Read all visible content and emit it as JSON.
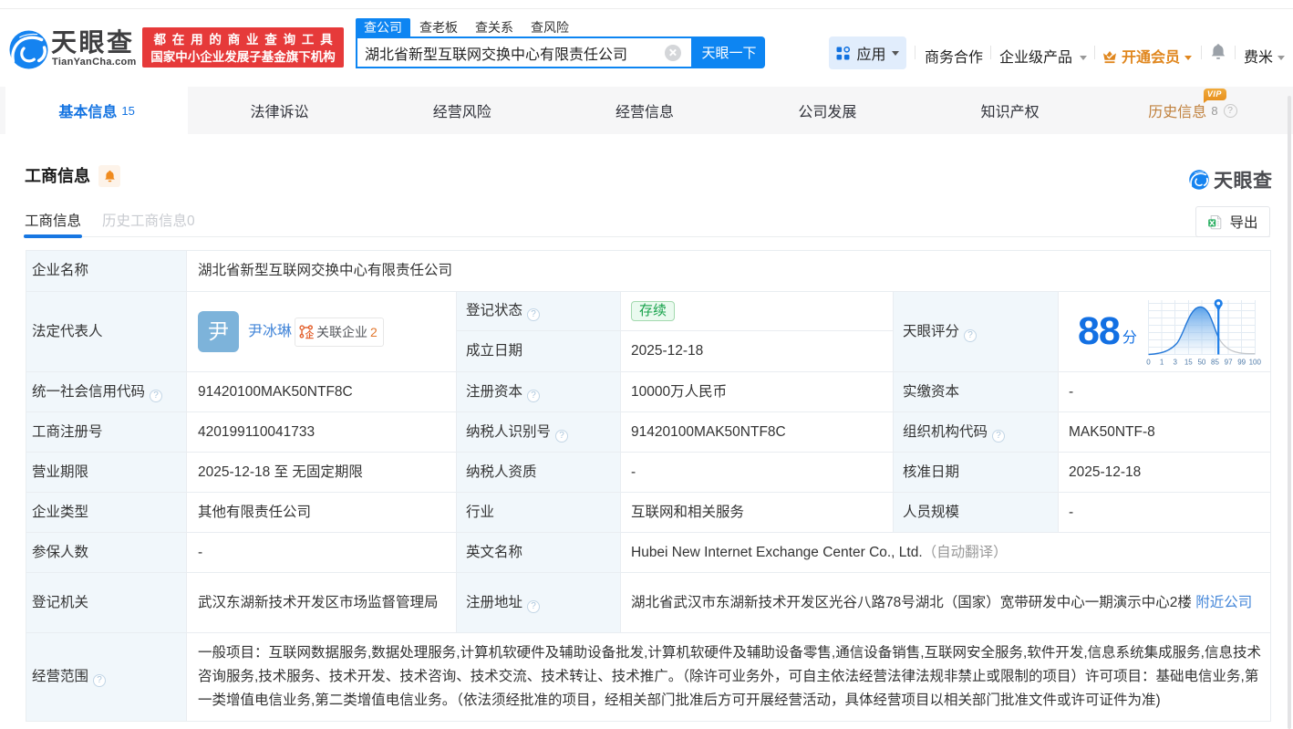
{
  "brand": {
    "name": "天眼查",
    "domain": "TianYanCha.com",
    "slogan_line1": "都在用的商业查询工具",
    "slogan_line2": "国家中小企业发展子基金旗下机构"
  },
  "search": {
    "tabs": [
      "查公司",
      "查老板",
      "查关系",
      "查风险"
    ],
    "active_tab": "查公司",
    "value": "湖北省新型互联网交换中心有限责任公司",
    "button": "天眼一下"
  },
  "topnav": {
    "apps": "应用",
    "cooperation": "商务合作",
    "enterprise": "企业级产品",
    "vip": "开通会员",
    "user": "费米"
  },
  "nav_tabs": [
    {
      "label": "基本信息",
      "count": "15"
    },
    {
      "label": "法律诉讼"
    },
    {
      "label": "经营风险"
    },
    {
      "label": "经营信息"
    },
    {
      "label": "公司发展"
    },
    {
      "label": "知识产权"
    },
    {
      "label": "历史信息",
      "count": "8",
      "vip": "VIP"
    }
  ],
  "section": {
    "title": "工商信息",
    "subtab_active": "工商信息",
    "subtab_history": "历史工商信息0",
    "export": "导出",
    "watermark": "天眼查"
  },
  "table": {
    "company_name_label": "企业名称",
    "company_name": "湖北省新型互联网交换中心有限责任公司",
    "legal_rep_label": "法定代表人",
    "legal_rep_avatar": "尹",
    "legal_rep_name": "尹冰琳",
    "legal_rep_badge": "关联企业",
    "legal_rep_badge_count": "2",
    "reg_status_label": "登记状态",
    "reg_status": "存续",
    "establish_date_label": "成立日期",
    "establish_date": "2025-12-18",
    "score_label": "天眼评分",
    "uscc_label": "统一社会信用代码",
    "uscc": "91420100MAK50NTF8C",
    "reg_capital_label": "注册资本",
    "reg_capital": "10000万人民币",
    "paid_capital_label": "实缴资本",
    "paid_capital": "-",
    "reg_number_label": "工商注册号",
    "reg_number": "420199110041733",
    "taxpayer_id_label": "纳税人识别号",
    "taxpayer_id": "91420100MAK50NTF8C",
    "org_code_label": "组织机构代码",
    "org_code": "MAK50NTF-8",
    "business_term_label": "营业期限",
    "business_term": "2025-12-18 至 无固定期限",
    "taxpayer_quality_label": "纳税人资质",
    "taxpayer_quality": "-",
    "approved_date_label": "核准日期",
    "approved_date": "2025-12-18",
    "company_type_label": "企业类型",
    "company_type": "其他有限责任公司",
    "industry_label": "行业",
    "industry": "互联网和相关服务",
    "staff_size_label": "人员规模",
    "staff_size": "-",
    "insured_count_label": "参保人数",
    "insured_count": "-",
    "english_name_label": "英文名称",
    "english_name": "Hubei New Internet Exchange Center Co., Ltd.",
    "english_name_note": "（自动翻译）",
    "reg_authority_label": "登记机关",
    "reg_authority": "武汉东湖新技术开发区市场监督管理局",
    "reg_address_label": "注册地址",
    "reg_address": "湖北省武汉市东湖新技术开发区光谷八路78号湖北（国家）宽带研发中心一期演示中心2楼",
    "reg_address_link": "附近公司",
    "business_scope_label": "经营范围",
    "business_scope": "一般项目：互联网数据服务,数据处理服务,计算机软硬件及辅助设备批发,计算机软硬件及辅助设备零售,通信设备销售,互联网安全服务,软件开发,信息系统集成服务,信息技术咨询服务,技术服务、技术开发、技术咨询、技术交流、技术转让、技术推广。（除许可业务外，可自主依法经营法律法规非禁止或限制的项目）许可项目：基础电信业务,第一类增值电信业务,第二类增值电信业务。（依法须经批准的项目，经相关部门批准后方可开展经营活动，具体经营项目以相关部门批准文件或许可证件为准)"
  },
  "chart_data": {
    "type": "area",
    "title": "天眼评分",
    "score": 88,
    "unit": "分",
    "x_tick_labels": [
      "0",
      "1",
      "3",
      "15",
      "50",
      "85",
      "97",
      "99",
      "100"
    ],
    "marker_value": 88,
    "curve_shape": "right-skewed bell curve peaking near the 50 tick with marker pin at score 88",
    "legend": "none",
    "grid": "on",
    "colors": {
      "curve": "#2176d8",
      "fill_top": "#5ba4ec",
      "marker": "#1f7fe8",
      "tail": "#c3c6ca"
    }
  },
  "colors": {
    "primary_blue": "#0d85f2",
    "link_blue": "#4285d8",
    "banner_red": "#e63a3a",
    "vip_orange": "#e0871f",
    "history_tab_orange": "#c0813e",
    "status_green": "#17a24b",
    "label_cell_bg": "#f1f7fb"
  },
  "icons": {
    "question_mark": "?",
    "badge_char": "企"
  }
}
